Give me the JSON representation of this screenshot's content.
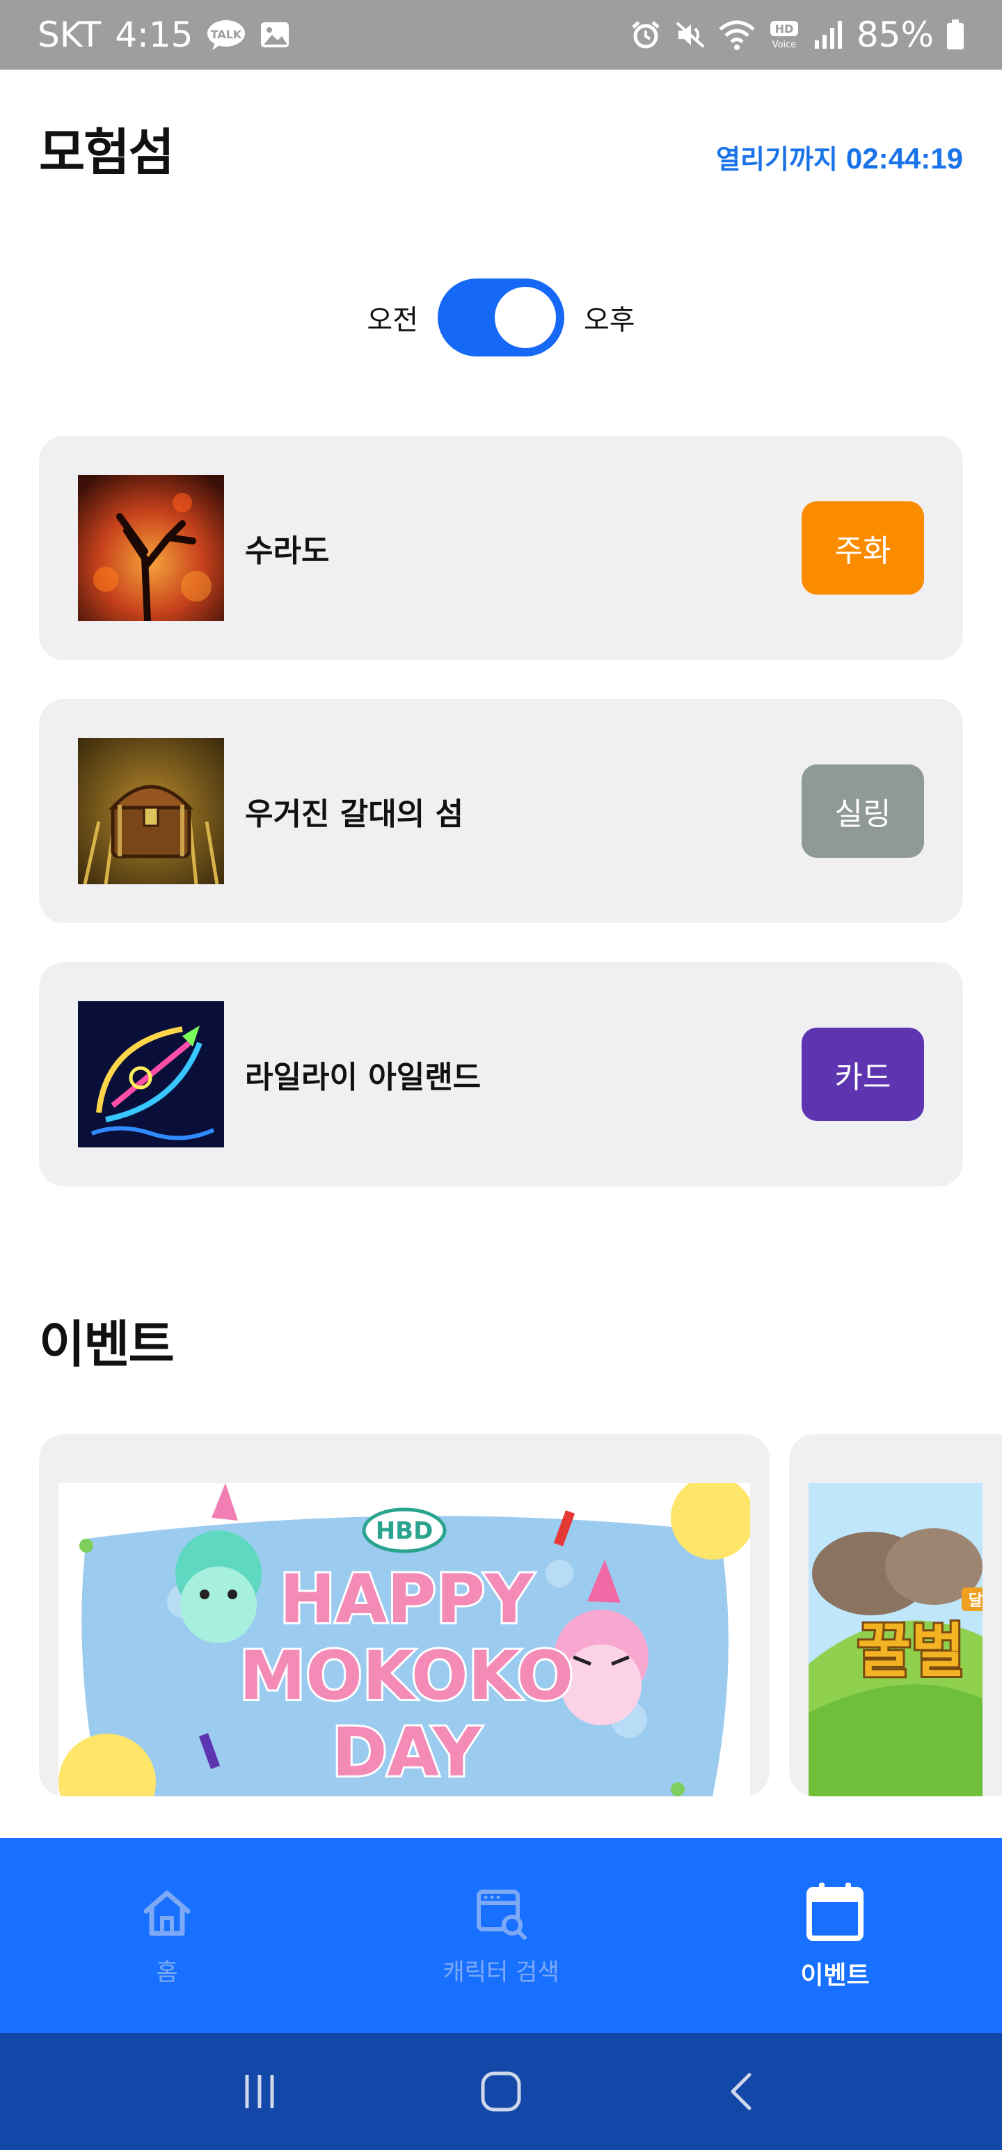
{
  "status_bar": {
    "carrier": "SKT",
    "time": "4:15",
    "battery": "85%",
    "talk_badge": "TALK",
    "hd_top": "HD",
    "hd_bottom": "Voice"
  },
  "header": {
    "title": "모험섬",
    "countdown_label": "열리기까지",
    "countdown_time": "02:44:19"
  },
  "toggle": {
    "left_label": "오전",
    "right_label": "오후",
    "selected": "오후"
  },
  "islands": [
    {
      "name": "수라도",
      "reward": "주화",
      "reward_color": "#fb8c00",
      "icon": "burning-tree-icon"
    },
    {
      "name": "우거진 갈대의 섬",
      "reward": "실링",
      "reward_color": "#8f9a95",
      "icon": "treasure-chest-icon"
    },
    {
      "name": "라일라이 아일랜드",
      "reward": "카드",
      "reward_color": "#5e35b1",
      "icon": "neon-bow-icon"
    }
  ],
  "events": {
    "title": "이벤트",
    "cards": [
      {
        "badge": "HBD",
        "line1": "HAPPY",
        "line2": "MOKOKO",
        "line3": "DAY"
      },
      {
        "badge": "달",
        "line1": "꿀벌"
      }
    ]
  },
  "bottom_nav": {
    "items": [
      {
        "label": "홈",
        "icon": "home-icon",
        "active": false
      },
      {
        "label": "캐릭터 검색",
        "icon": "character-search-icon",
        "active": false
      },
      {
        "label": "이벤트",
        "icon": "calendar-icon",
        "active": true
      }
    ]
  },
  "colors": {
    "accent": "#1770ff",
    "countdown": "#1a73e8",
    "card_bg": "#f0f0f3"
  }
}
